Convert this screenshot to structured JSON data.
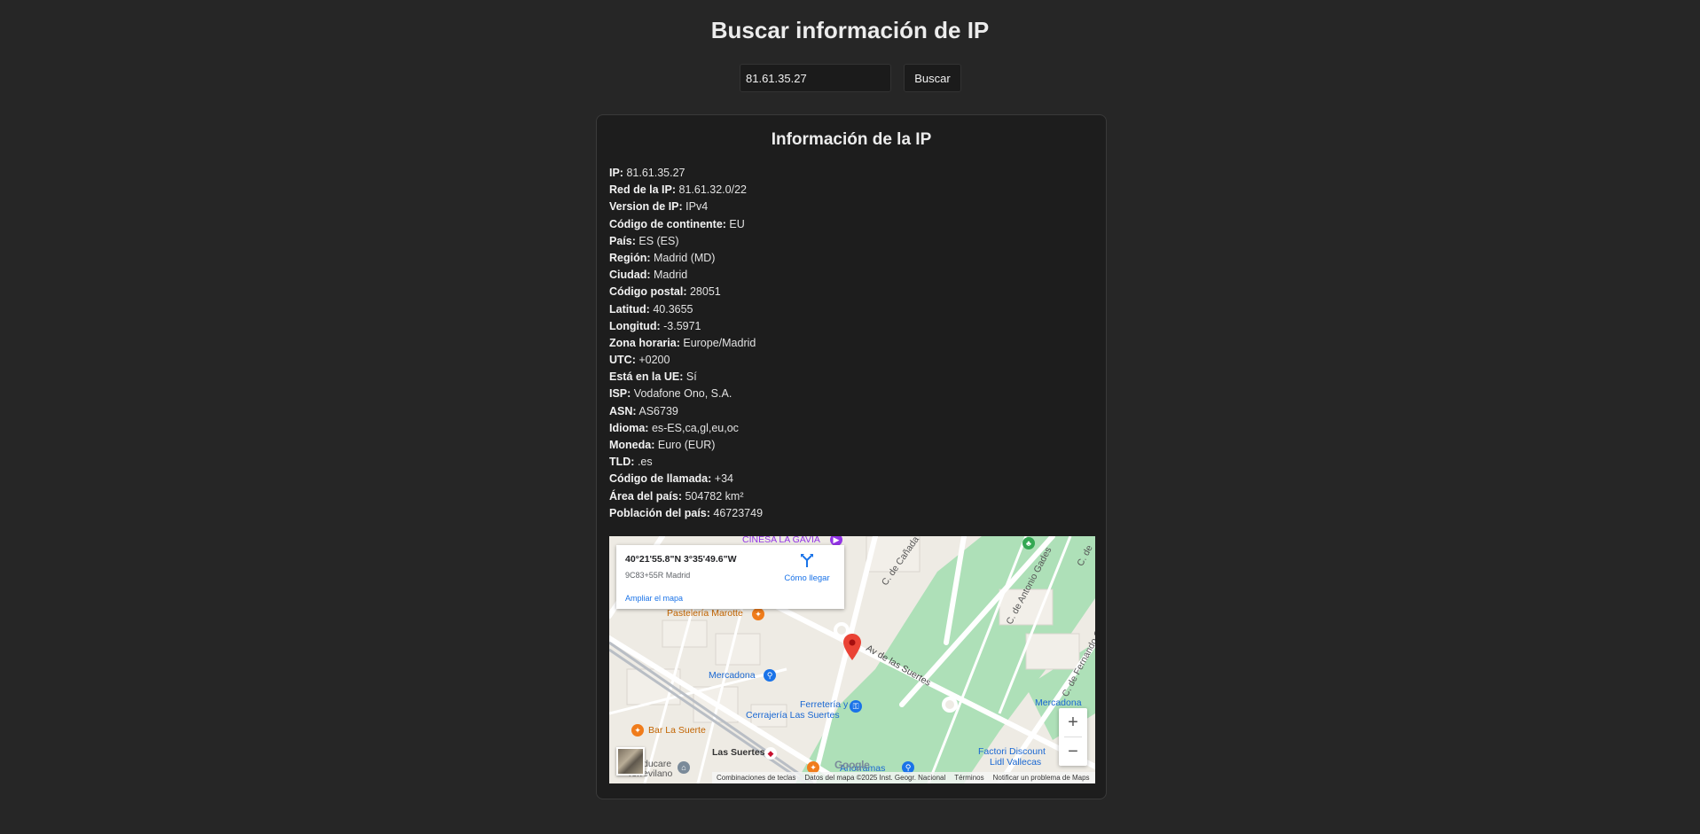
{
  "page": {
    "title": "Buscar información de IP"
  },
  "search": {
    "value": "81.61.35.27",
    "button_label": "Buscar"
  },
  "card": {
    "title": "Información de la IP",
    "fields": [
      {
        "label": "IP:",
        "value": "81.61.35.27"
      },
      {
        "label": "Red de la IP:",
        "value": "81.61.32.0/22"
      },
      {
        "label": "Version de IP:",
        "value": "IPv4"
      },
      {
        "label": "Código de continente:",
        "value": "EU"
      },
      {
        "label": "País:",
        "value": "ES (ES)"
      },
      {
        "label": "Región:",
        "value": "Madrid (MD)"
      },
      {
        "label": "Ciudad:",
        "value": "Madrid"
      },
      {
        "label": "Código postal:",
        "value": "28051"
      },
      {
        "label": "Latitud:",
        "value": "40.3655"
      },
      {
        "label": "Longitud:",
        "value": "-3.5971"
      },
      {
        "label": "Zona horaria:",
        "value": "Europe/Madrid"
      },
      {
        "label": "UTC:",
        "value": "+0200"
      },
      {
        "label": "Está en la UE:",
        "value": "Sí"
      },
      {
        "label": "ISP:",
        "value": "Vodafone Ono, S.A."
      },
      {
        "label": "ASN:",
        "value": "AS6739"
      },
      {
        "label": "Idioma:",
        "value": "es-ES,ca,gl,eu,oc"
      },
      {
        "label": "Moneda:",
        "value": "Euro (EUR)"
      },
      {
        "label": "TLD:",
        "value": ".es"
      },
      {
        "label": "Código de llamada:",
        "value": "+34"
      },
      {
        "label": "Área del país:",
        "value": "504782 km²"
      },
      {
        "label": "Población del país:",
        "value": "46723749"
      }
    ]
  },
  "map": {
    "popup": {
      "coords": "40°21'55.8\"N 3°35'49.6\"W",
      "plus_code": "9C83+55R Madrid",
      "enlarge_label": "Ampliar el mapa",
      "directions_label": "Cómo llegar"
    },
    "labels": {
      "cinesa": "CINESA LA GAVIA",
      "pasteleria": "Pastelería Marotte",
      "mercadona1": "Mercadona",
      "ferreteria": "Ferretería y",
      "cerrajeria": "Cerrajería Las Suertes",
      "bar": "Bar La Suerte",
      "las_suertes": "Las Suertes",
      "ducare": "ducare",
      "torrevilano": "Torrevilano",
      "ahorramas": "Ahorramas",
      "calle_canada": "C. de Cañada",
      "av_suertes": "Av de las Suertes",
      "calle_gades": "C. de Antonio Gades",
      "calle_fernando": "C. de Fernando Ch",
      "calle_c": "C. de",
      "mercadona2": "Mercadona",
      "factori": "Factori Discount",
      "lidl": "Lidl Vallecas",
      "google": "Google"
    },
    "zoom_in": "+",
    "zoom_out": "−",
    "attribution": {
      "shortcuts": "Combinaciones de teclas",
      "data": "Datos del mapa ©2025 Inst. Geogr. Nacional",
      "terms": "Términos",
      "report": "Notificar un problema de Maps"
    },
    "colors": {
      "park": "#aee0b8",
      "road": "#ffffff",
      "base": "#eeebe4",
      "pin": "#ea4335",
      "poi_orange": "#f07c1b",
      "poi_blue": "#1a73e8"
    }
  }
}
